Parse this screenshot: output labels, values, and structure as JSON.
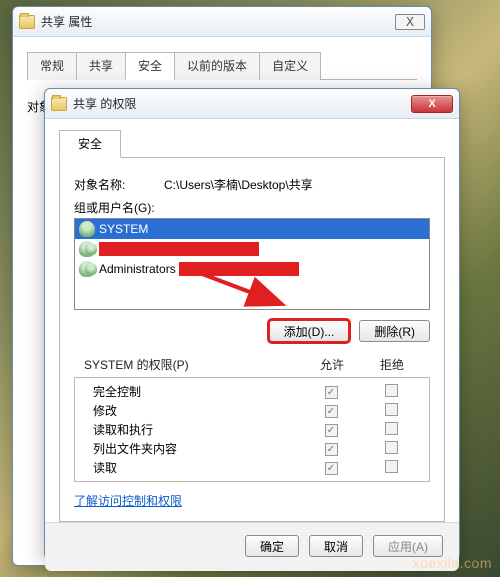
{
  "back_window": {
    "title": "共享 属性",
    "tabs": [
      "常规",
      "共享",
      "安全",
      "以前的版本",
      "自定义"
    ],
    "active_tab_index": 2,
    "object_name_label": "对象名称:"
  },
  "front_window": {
    "title": "共享 的权限",
    "tab_label": "安全",
    "object_name_label": "对象名称:",
    "object_name_value": "C:\\Users\\李楠\\Desktop\\共享",
    "groups_label": "组或用户名(G):",
    "users": [
      {
        "name": "SYSTEM",
        "selected": true,
        "redacted": false,
        "double_icon": false
      },
      {
        "name": "",
        "selected": false,
        "redacted": true,
        "double_icon": true
      },
      {
        "name": "Administrators",
        "selected": false,
        "redacted": true,
        "double_icon": true
      }
    ],
    "add_button": "添加(D)...",
    "remove_button": "删除(R)",
    "perm_header": "SYSTEM 的权限(P)",
    "perm_allow": "允许",
    "perm_deny": "拒绝",
    "permissions": [
      {
        "label": "完全控制",
        "allow": true,
        "deny": false
      },
      {
        "label": "修改",
        "allow": true,
        "deny": false
      },
      {
        "label": "读取和执行",
        "allow": true,
        "deny": false
      },
      {
        "label": "列出文件夹内容",
        "allow": true,
        "deny": false
      },
      {
        "label": "读取",
        "allow": true,
        "deny": false
      }
    ],
    "learn_link": "了解访问控制和权限",
    "ok_button": "确定",
    "cancel_button": "取消",
    "apply_button": "应用(A)"
  },
  "watermark": "xuexila.com"
}
